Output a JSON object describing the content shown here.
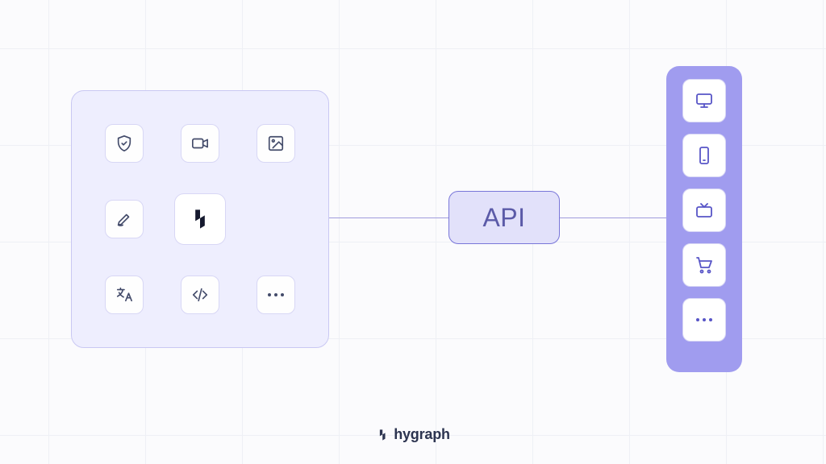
{
  "api": {
    "label": "API"
  },
  "brand": {
    "name": "hygraph"
  },
  "sources": {
    "icons": [
      "shield",
      "video",
      "image",
      "edit",
      "logo",
      "blank",
      "translate",
      "code",
      "more"
    ]
  },
  "outputs": {
    "icons": [
      "monitor",
      "smartphone",
      "tv",
      "cart",
      "more"
    ]
  },
  "colors": {
    "panel_bg": "#eeeefe",
    "output_bg": "#a09cef",
    "api_border": "#7976d9"
  }
}
